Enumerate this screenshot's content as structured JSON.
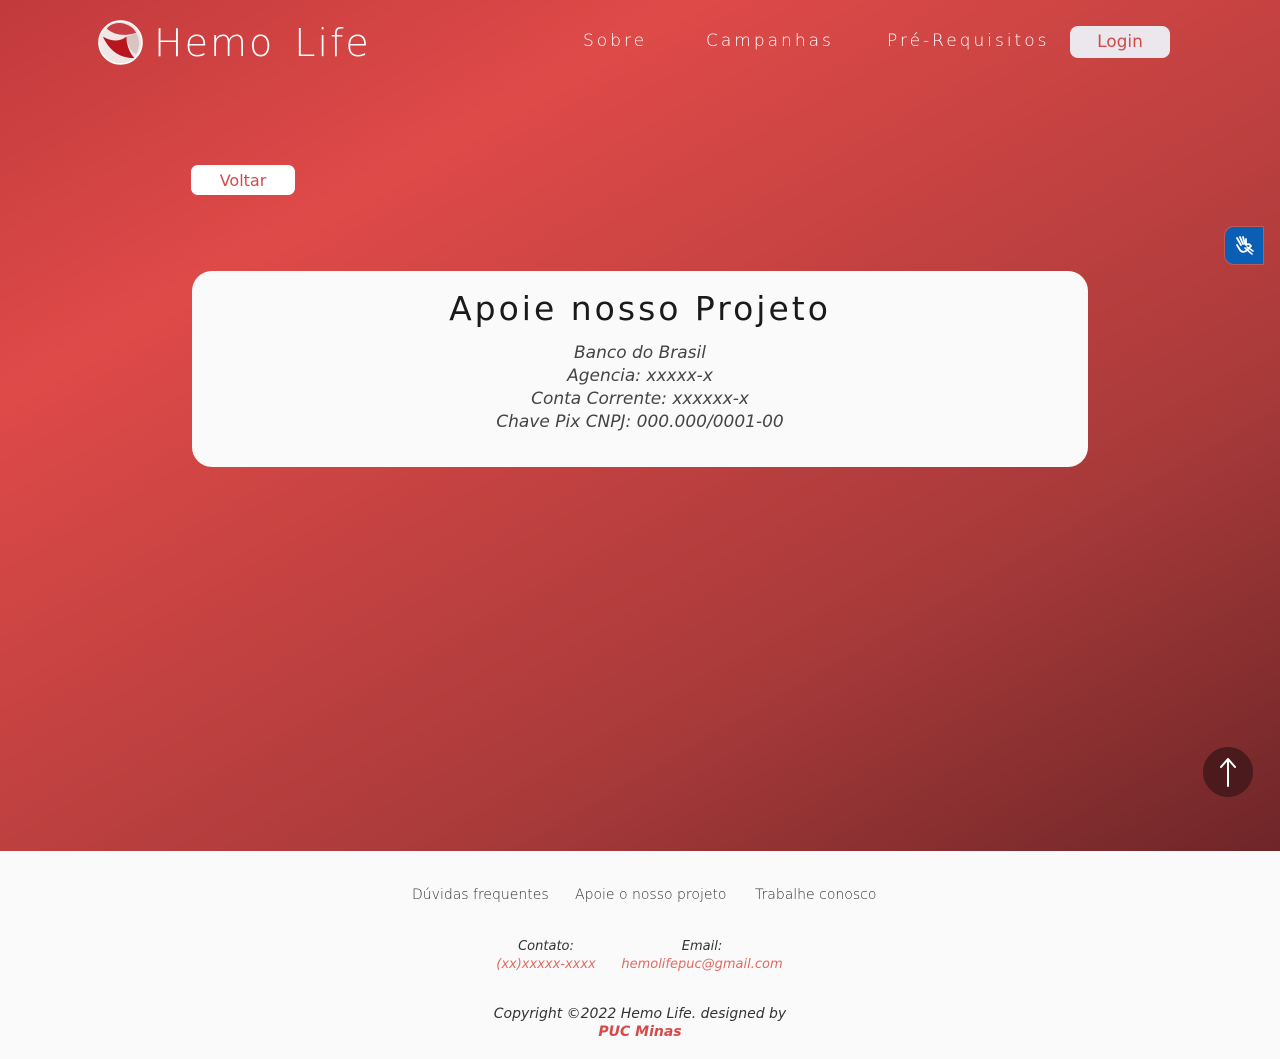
{
  "header": {
    "logo_text": "Hemo Life",
    "nav": [
      "Sobre",
      "Campanhas",
      "Pré-Requisitos"
    ],
    "login_label": "Login"
  },
  "back_label": "Voltar",
  "card": {
    "title": "Apoie nosso Projeto",
    "lines": [
      "Banco do Brasil",
      "Agencia: xxxxx-x",
      "Conta Corrente: xxxxxx-x",
      "Chave Pix CNPJ: 000.000/0001-00"
    ]
  },
  "scroll_top_icon": "arrow-up-icon",
  "accessibility_icon": "sign-language-icon",
  "footer": {
    "links": [
      "Dúvidas frequentes",
      "Apoie o nosso projeto",
      "Trabalhe conosco"
    ],
    "contact_label": "Contato:",
    "contact_value": "(xx)xxxxx-xxxx",
    "email_label": "Email:",
    "email_value": "hemolifepuc@gmail.com",
    "copyright": "Copyright ©2022 Hemo Life. designed by",
    "designer": "PUC Minas"
  },
  "colors": {
    "accent": "#d44a4a",
    "hero_start": "#de4a48",
    "hero_end": "#6e2628",
    "accessibility": "#0a5fb4"
  }
}
